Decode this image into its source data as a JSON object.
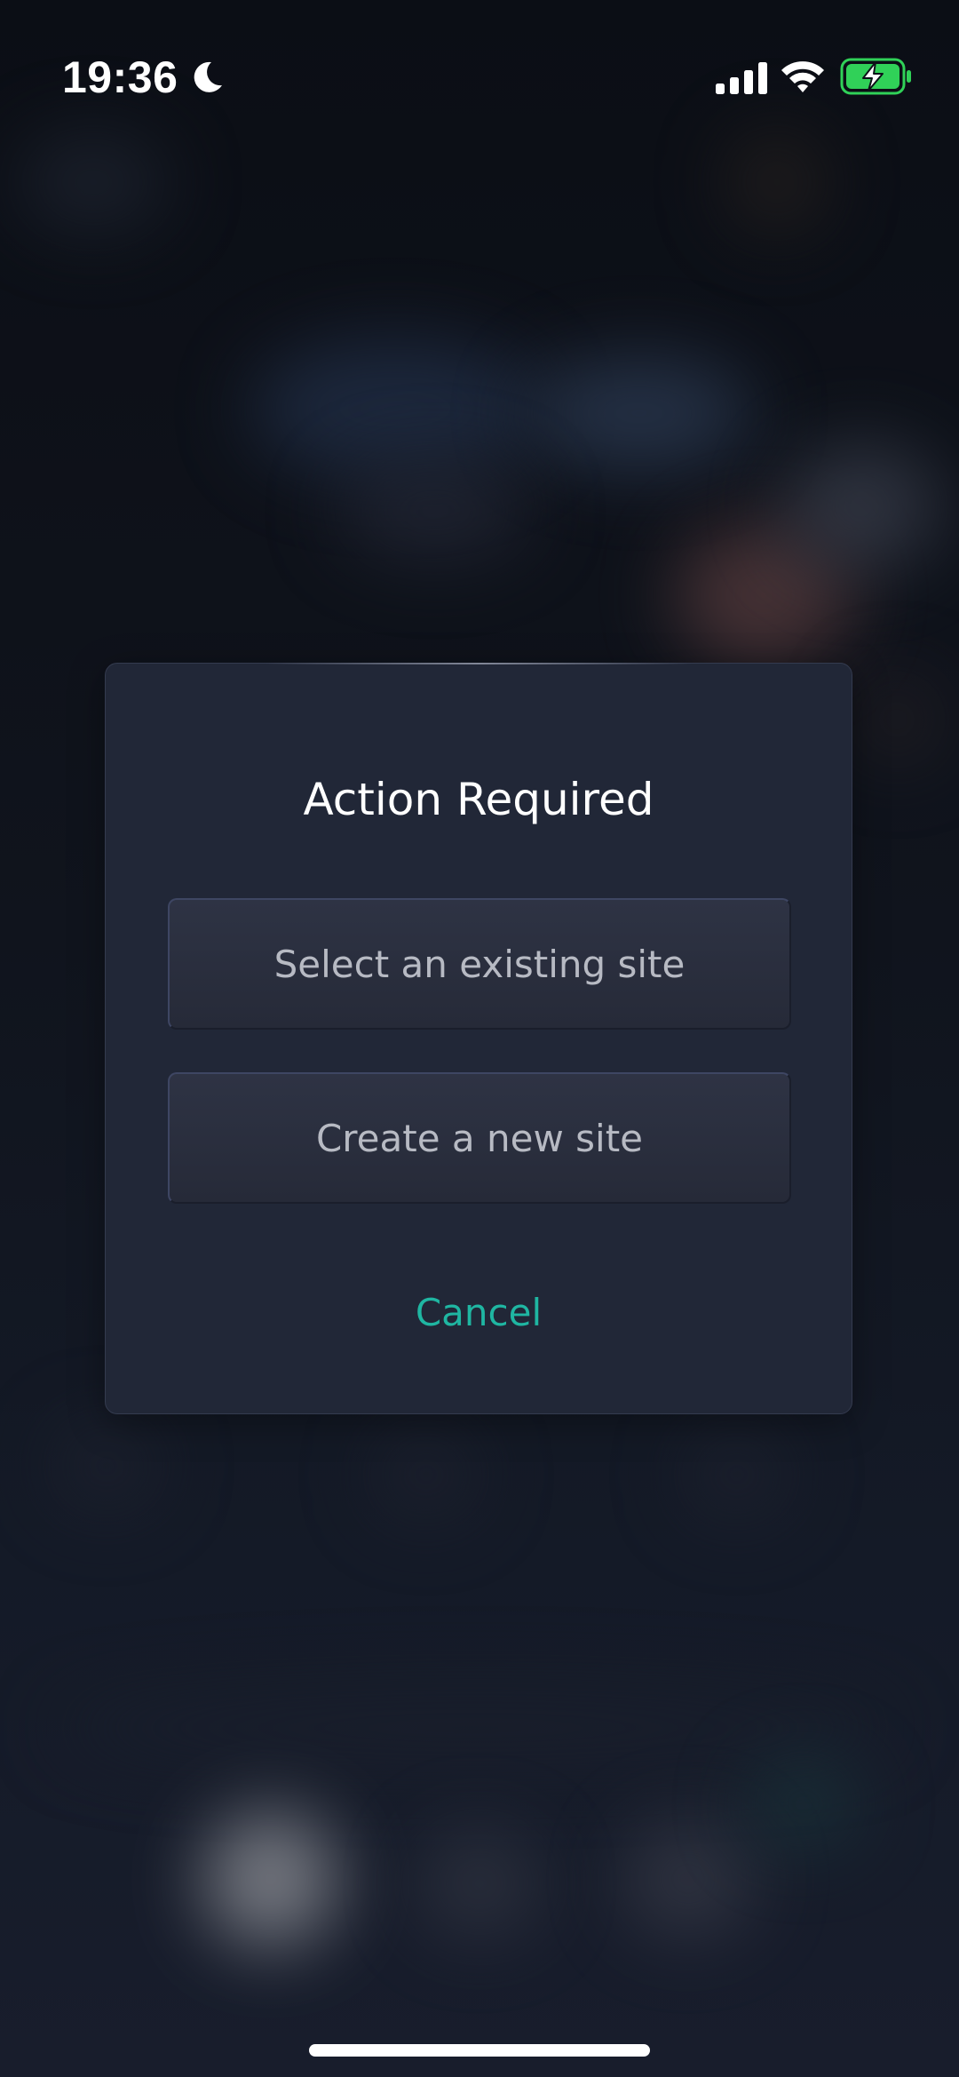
{
  "status_bar": {
    "time": "19:36",
    "focus_icon": "moon-icon",
    "signal_icon": "cellular-signal-icon",
    "wifi_icon": "wifi-icon",
    "battery_icon": "battery-charging-icon",
    "battery_color": "#30d158"
  },
  "dialog": {
    "title": "Action Required",
    "options": [
      {
        "label": "Select an existing site"
      },
      {
        "label": "Create a new site"
      }
    ],
    "cancel_label": "Cancel",
    "accent_color": "#1fb6a2"
  }
}
